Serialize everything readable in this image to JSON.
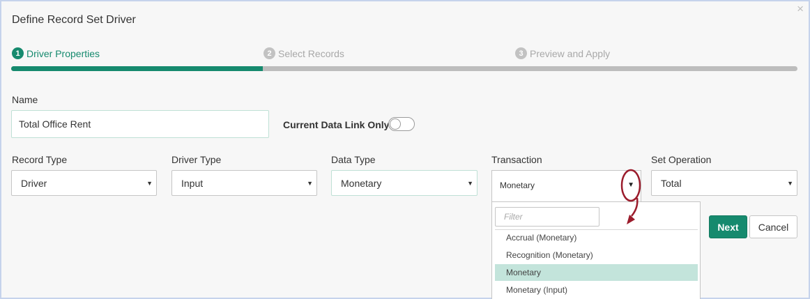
{
  "dialog": {
    "title": "Define Record Set Driver",
    "close_glyph": "×",
    "progress_fraction": 0.32
  },
  "steps": [
    {
      "number": "1",
      "label": "Driver Properties",
      "state": "active"
    },
    {
      "number": "2",
      "label": "Select Records",
      "state": "inactive"
    },
    {
      "number": "3",
      "label": "Preview and Apply",
      "state": "inactive"
    }
  ],
  "name": {
    "label": "Name",
    "value": "Total Office Rent"
  },
  "current_data_link_only": {
    "label": "Current Data Link Only",
    "checked": false
  },
  "record_type": {
    "label": "Record Type",
    "value": "Driver"
  },
  "driver_type": {
    "label": "Driver Type",
    "value": "Input"
  },
  "data_type": {
    "label": "Data Type",
    "value": "Monetary"
  },
  "transaction": {
    "label": "Transaction",
    "value": "Monetary",
    "filter_placeholder": "Filter",
    "options": [
      "Accrual (Monetary)",
      "Recognition (Monetary)",
      "Monetary",
      "Monetary (Input)"
    ],
    "selected_index": 2
  },
  "set_operation": {
    "label": "Set Operation",
    "value": "Total"
  },
  "buttons": {
    "next_label": "Next",
    "cancel_label": "Cancel"
  },
  "icons": {
    "caret": "▼"
  },
  "colors": {
    "accent": "#168a6e",
    "selected_option_bg": "#c3e4db",
    "annotation": "#9b1c2c"
  }
}
